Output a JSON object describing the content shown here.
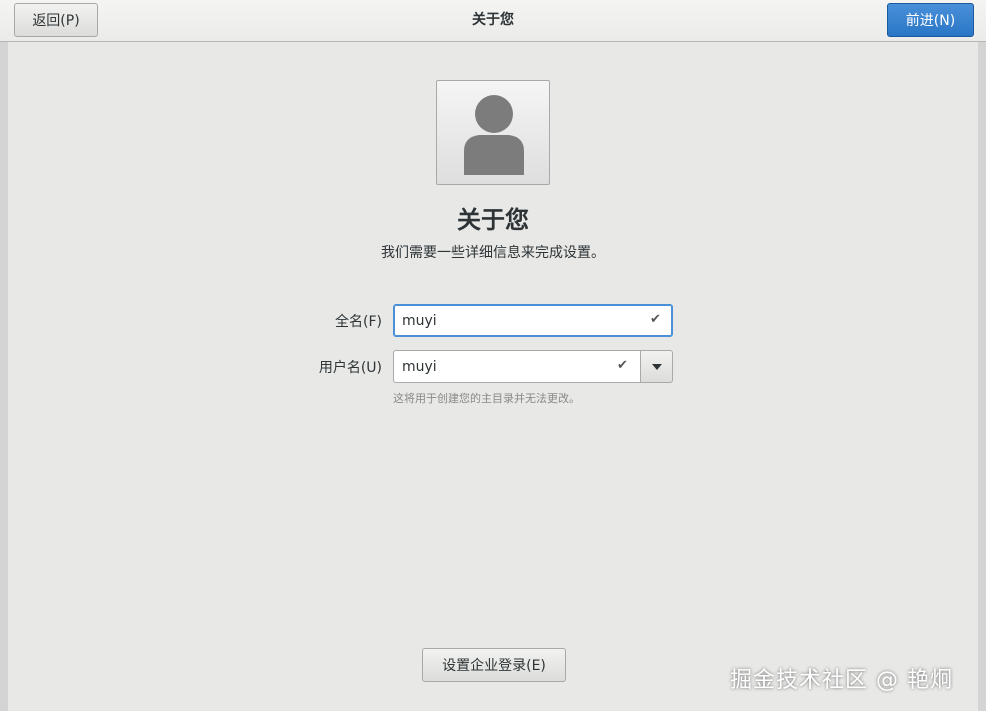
{
  "header": {
    "back_label": "返回(P)",
    "title": "关于您",
    "next_label": "前进(N)"
  },
  "main": {
    "title": "关于您",
    "subtitle": "我们需要一些详细信息来完成设置。",
    "full_name": {
      "label": "全名(F)",
      "value": "muyi",
      "status_icon": "checkmark-icon"
    },
    "username": {
      "label": "用户名(U)",
      "value": "muyi",
      "status_icon": "checkmark-icon",
      "hint": "这将用于创建您的主目录并无法更改。"
    },
    "enterprise_button_label": "设置企业登录(E)"
  },
  "watermark": "掘金技术社区 @ 艳炯",
  "colors": {
    "accent": "#4a90d9",
    "background": "#e8e8e7"
  }
}
